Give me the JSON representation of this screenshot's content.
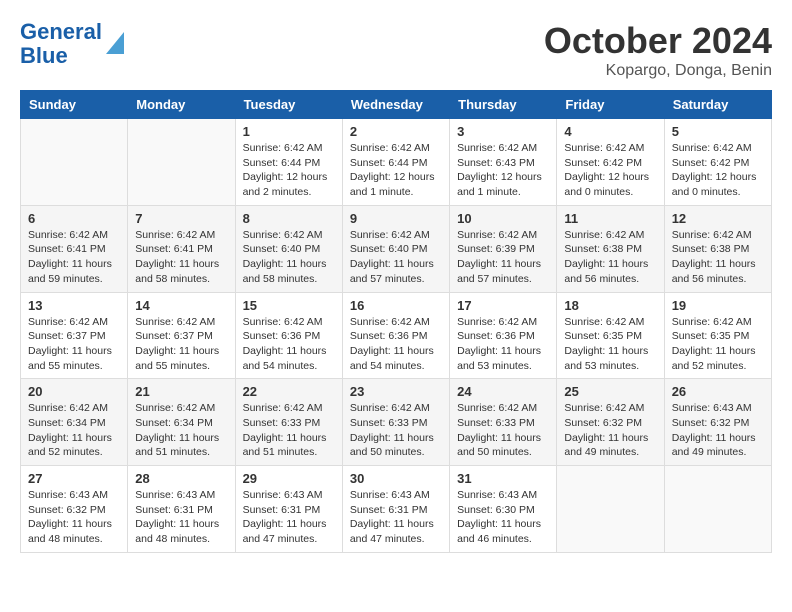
{
  "header": {
    "logo_line1": "General",
    "logo_line2": "Blue",
    "month": "October 2024",
    "location": "Kopargo, Donga, Benin"
  },
  "weekdays": [
    "Sunday",
    "Monday",
    "Tuesday",
    "Wednesday",
    "Thursday",
    "Friday",
    "Saturday"
  ],
  "weeks": [
    [
      {
        "day": "",
        "info": ""
      },
      {
        "day": "",
        "info": ""
      },
      {
        "day": "1",
        "info": "Sunrise: 6:42 AM\nSunset: 6:44 PM\nDaylight: 12 hours and 2 minutes."
      },
      {
        "day": "2",
        "info": "Sunrise: 6:42 AM\nSunset: 6:44 PM\nDaylight: 12 hours and 1 minute."
      },
      {
        "day": "3",
        "info": "Sunrise: 6:42 AM\nSunset: 6:43 PM\nDaylight: 12 hours and 1 minute."
      },
      {
        "day": "4",
        "info": "Sunrise: 6:42 AM\nSunset: 6:42 PM\nDaylight: 12 hours and 0 minutes."
      },
      {
        "day": "5",
        "info": "Sunrise: 6:42 AM\nSunset: 6:42 PM\nDaylight: 12 hours and 0 minutes."
      }
    ],
    [
      {
        "day": "6",
        "info": "Sunrise: 6:42 AM\nSunset: 6:41 PM\nDaylight: 11 hours and 59 minutes."
      },
      {
        "day": "7",
        "info": "Sunrise: 6:42 AM\nSunset: 6:41 PM\nDaylight: 11 hours and 58 minutes."
      },
      {
        "day": "8",
        "info": "Sunrise: 6:42 AM\nSunset: 6:40 PM\nDaylight: 11 hours and 58 minutes."
      },
      {
        "day": "9",
        "info": "Sunrise: 6:42 AM\nSunset: 6:40 PM\nDaylight: 11 hours and 57 minutes."
      },
      {
        "day": "10",
        "info": "Sunrise: 6:42 AM\nSunset: 6:39 PM\nDaylight: 11 hours and 57 minutes."
      },
      {
        "day": "11",
        "info": "Sunrise: 6:42 AM\nSunset: 6:38 PM\nDaylight: 11 hours and 56 minutes."
      },
      {
        "day": "12",
        "info": "Sunrise: 6:42 AM\nSunset: 6:38 PM\nDaylight: 11 hours and 56 minutes."
      }
    ],
    [
      {
        "day": "13",
        "info": "Sunrise: 6:42 AM\nSunset: 6:37 PM\nDaylight: 11 hours and 55 minutes."
      },
      {
        "day": "14",
        "info": "Sunrise: 6:42 AM\nSunset: 6:37 PM\nDaylight: 11 hours and 55 minutes."
      },
      {
        "day": "15",
        "info": "Sunrise: 6:42 AM\nSunset: 6:36 PM\nDaylight: 11 hours and 54 minutes."
      },
      {
        "day": "16",
        "info": "Sunrise: 6:42 AM\nSunset: 6:36 PM\nDaylight: 11 hours and 54 minutes."
      },
      {
        "day": "17",
        "info": "Sunrise: 6:42 AM\nSunset: 6:36 PM\nDaylight: 11 hours and 53 minutes."
      },
      {
        "day": "18",
        "info": "Sunrise: 6:42 AM\nSunset: 6:35 PM\nDaylight: 11 hours and 53 minutes."
      },
      {
        "day": "19",
        "info": "Sunrise: 6:42 AM\nSunset: 6:35 PM\nDaylight: 11 hours and 52 minutes."
      }
    ],
    [
      {
        "day": "20",
        "info": "Sunrise: 6:42 AM\nSunset: 6:34 PM\nDaylight: 11 hours and 52 minutes."
      },
      {
        "day": "21",
        "info": "Sunrise: 6:42 AM\nSunset: 6:34 PM\nDaylight: 11 hours and 51 minutes."
      },
      {
        "day": "22",
        "info": "Sunrise: 6:42 AM\nSunset: 6:33 PM\nDaylight: 11 hours and 51 minutes."
      },
      {
        "day": "23",
        "info": "Sunrise: 6:42 AM\nSunset: 6:33 PM\nDaylight: 11 hours and 50 minutes."
      },
      {
        "day": "24",
        "info": "Sunrise: 6:42 AM\nSunset: 6:33 PM\nDaylight: 11 hours and 50 minutes."
      },
      {
        "day": "25",
        "info": "Sunrise: 6:42 AM\nSunset: 6:32 PM\nDaylight: 11 hours and 49 minutes."
      },
      {
        "day": "26",
        "info": "Sunrise: 6:43 AM\nSunset: 6:32 PM\nDaylight: 11 hours and 49 minutes."
      }
    ],
    [
      {
        "day": "27",
        "info": "Sunrise: 6:43 AM\nSunset: 6:32 PM\nDaylight: 11 hours and 48 minutes."
      },
      {
        "day": "28",
        "info": "Sunrise: 6:43 AM\nSunset: 6:31 PM\nDaylight: 11 hours and 48 minutes."
      },
      {
        "day": "29",
        "info": "Sunrise: 6:43 AM\nSunset: 6:31 PM\nDaylight: 11 hours and 47 minutes."
      },
      {
        "day": "30",
        "info": "Sunrise: 6:43 AM\nSunset: 6:31 PM\nDaylight: 11 hours and 47 minutes."
      },
      {
        "day": "31",
        "info": "Sunrise: 6:43 AM\nSunset: 6:30 PM\nDaylight: 11 hours and 46 minutes."
      },
      {
        "day": "",
        "info": ""
      },
      {
        "day": "",
        "info": ""
      }
    ]
  ]
}
